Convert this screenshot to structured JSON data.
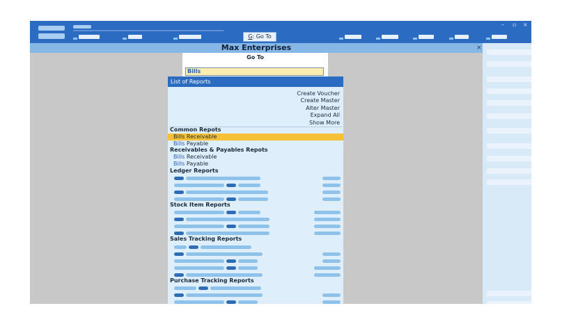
{
  "window": {
    "controls": [
      "–",
      "▫",
      "×"
    ],
    "company_title": "Max Enterprises",
    "close": "×"
  },
  "toolbar": {
    "goto_key": "G",
    "goto_label": ": Go To"
  },
  "goto": {
    "title": "Go To",
    "value": "Bills"
  },
  "reports": {
    "header": "List of Reports",
    "actions": [
      "Create Voucher",
      "Create Master",
      "Alter Master",
      "Expand All",
      "Show More"
    ],
    "search_match": "Bills",
    "sections": {
      "common": {
        "title": "Common Repots",
        "items": [
          {
            "match": "Bills",
            "rest": " Receivable",
            "selected": true
          },
          {
            "match": "Bills",
            "rest": " Payable",
            "selected": false
          }
        ]
      },
      "receivables": {
        "title": "Receivables & Payables Repots",
        "items": [
          {
            "match": "Bills",
            "rest": " Receivable",
            "selected": false
          },
          {
            "match": "Bills",
            "rest": " Payable",
            "selected": false
          }
        ]
      },
      "ledger": {
        "title": "Ledger Reports"
      },
      "stock": {
        "title": "Stock Item Reports"
      },
      "sales": {
        "title": "Sales Tracking Reports"
      },
      "purchase": {
        "title": "Purchase Tracking Reports"
      }
    }
  },
  "colors": {
    "toolbar": "#2b6cc2",
    "title_bar": "#86b7e6",
    "selection": "#f6c136",
    "panel": "#deeefb",
    "search_input": "#fbeeb0"
  }
}
